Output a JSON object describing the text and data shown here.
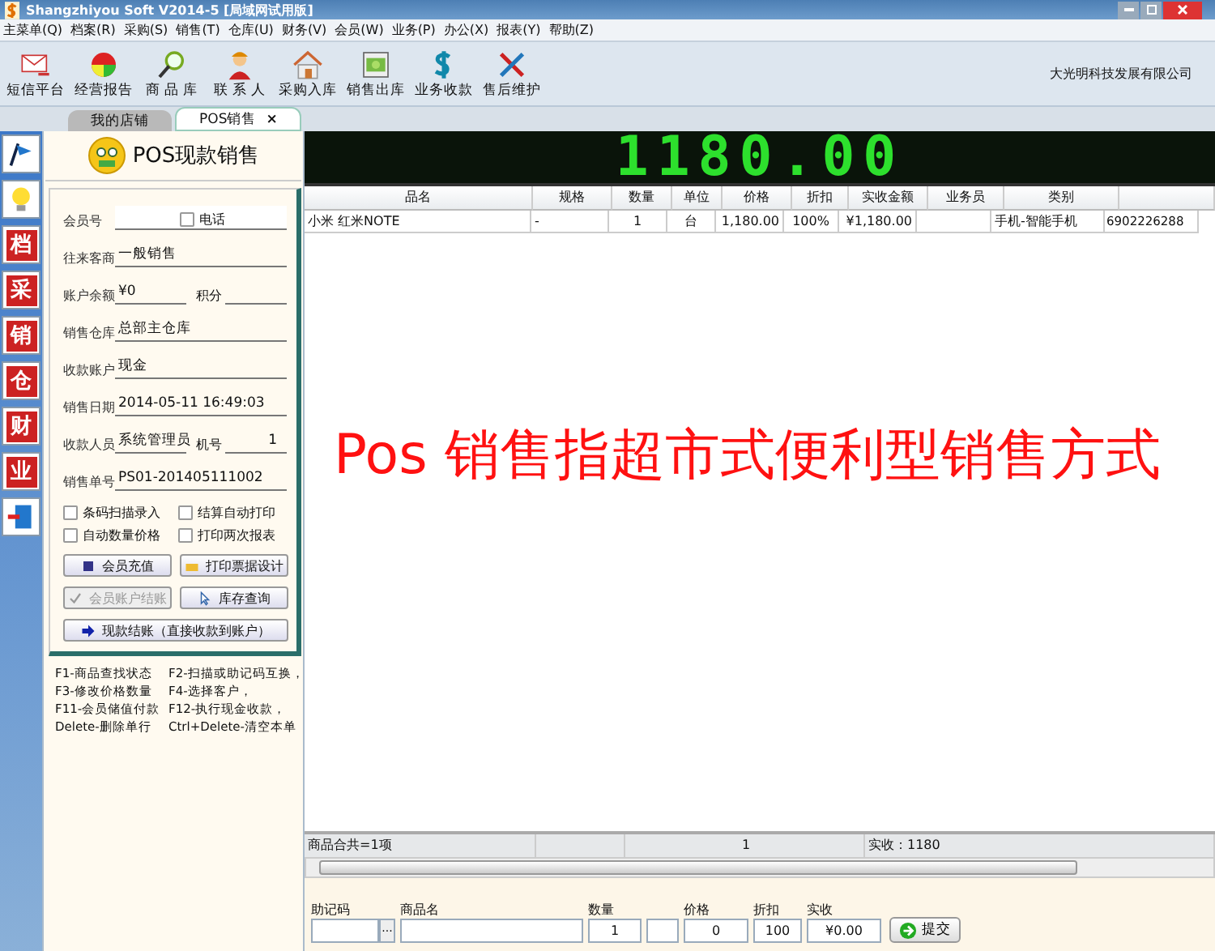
{
  "window": {
    "title": "Shangzhiyou Soft V2014-5 [局域网试用版]"
  },
  "menu": [
    "主菜单(Q)",
    "档案(R)",
    "采购(S)",
    "销售(T)",
    "仓库(U)",
    "财务(V)",
    "会员(W)",
    "业务(P)",
    "办公(X)",
    "报表(Y)",
    "帮助(Z)"
  ],
  "toolbar": [
    {
      "kind": "mail",
      "label": "短信平台"
    },
    {
      "kind": "chart",
      "label": "经营报告"
    },
    {
      "kind": "search",
      "label": "商 品 库"
    },
    {
      "kind": "person",
      "label": "联 系 人"
    },
    {
      "kind": "house",
      "label": "采购入库"
    },
    {
      "kind": "money",
      "label": "销售出库"
    },
    {
      "kind": "dollar",
      "label": "业务收款"
    },
    {
      "kind": "tools",
      "label": "售后维护"
    }
  ],
  "company": "大光明科技发展有限公司",
  "tabs": [
    {
      "label": "我的店铺",
      "selected": false
    },
    {
      "label": "POS销售",
      "selected": true,
      "close": "×"
    }
  ],
  "sidebar": [
    {
      "kind": "flag"
    },
    {
      "kind": "bulb"
    },
    {
      "kind": "char",
      "char": "档"
    },
    {
      "kind": "char",
      "char": "采"
    },
    {
      "kind": "char",
      "char": "销"
    },
    {
      "kind": "char",
      "char": "仓"
    },
    {
      "kind": "char",
      "char": "财"
    },
    {
      "kind": "char",
      "char": "业"
    },
    {
      "kind": "exit"
    }
  ],
  "panel": {
    "title": "POS现款销售",
    "fields": [
      {
        "kind": "check",
        "label": "会员号",
        "check": {
          "label": "电话",
          "checked": false
        }
      },
      {
        "kind": "text",
        "label": "往来客商",
        "value": "一般销售"
      },
      {
        "kind": "pair",
        "label": "账户余额",
        "value": "¥0",
        "label2": "积分"
      },
      {
        "kind": "text",
        "label": "销售仓库",
        "value": "总部主仓库"
      },
      {
        "kind": "text",
        "label": "收款账户",
        "value": "现金"
      },
      {
        "kind": "text",
        "label": "销售日期",
        "value": "2014-05-11 16:49:03"
      },
      {
        "kind": "pair",
        "label": "收款人员",
        "value": "系统管理员",
        "label2": "机号",
        "value2": "1"
      },
      {
        "kind": "text",
        "label": "销售单号",
        "value": "PS01-201405111002"
      }
    ],
    "options": [
      {
        "label": "条码扫描录入",
        "checked": false
      },
      {
        "label": "结算自动打印",
        "checked": false
      },
      {
        "label": "自动数量价格",
        "checked": false
      },
      {
        "label": "打印两次报表",
        "checked": false
      }
    ],
    "buttons": [
      {
        "kind": "card",
        "label": "会员充值",
        "disabled": false
      },
      {
        "kind": "print",
        "label": "打印票据设计",
        "disabled": false
      },
      {
        "kind": "check",
        "label": "会员账户结账",
        "disabled": true
      },
      {
        "kind": "pointer",
        "label": "库存查询",
        "disabled": false
      },
      {
        "kind": "arrow",
        "label": "现款结账（直接收款到账户）",
        "disabled": false
      }
    ],
    "hints": [
      "F1-商品查找状态",
      "F2-扫描或助记码互换，",
      "F3-修改价格数量",
      "F4-选择客户，",
      "F11-会员储值付款",
      "F12-执行现金收款，",
      "Delete-删除单行",
      "Ctrl+Delete-清空本单"
    ]
  },
  "display": "1180.00",
  "table": {
    "columns": [
      "品名",
      "规格",
      "数量",
      "单位",
      "价格",
      "折扣",
      "实收金额",
      "业务员",
      "类别"
    ],
    "rows": [
      {
        "cells": [
          "小米 红米NOTE",
          "-",
          "1",
          "台",
          "1,180.00",
          "100%",
          "¥1,180.00",
          null,
          "手机-智能手机",
          "6902226288"
        ]
      }
    ]
  },
  "summary": {
    "count": "商品合共=1项",
    "quantity": "1",
    "received": "实收：1180"
  },
  "entry": {
    "fields": [
      {
        "kind": "code",
        "label": "助记码",
        "more": "···"
      },
      {
        "kind": "name",
        "label": "商品名"
      },
      {
        "kind": "num",
        "label": "数量",
        "value": "1"
      },
      {
        "kind": "blank"
      },
      {
        "kind": "num",
        "label": "价格",
        "value": "0"
      },
      {
        "kind": "num",
        "label": "折扣",
        "value": "100"
      },
      {
        "kind": "num",
        "label": "实收",
        "value": "¥0.00"
      }
    ],
    "submit": "提交"
  },
  "caption": "Pos 销售指超市式便利型销售方式"
}
